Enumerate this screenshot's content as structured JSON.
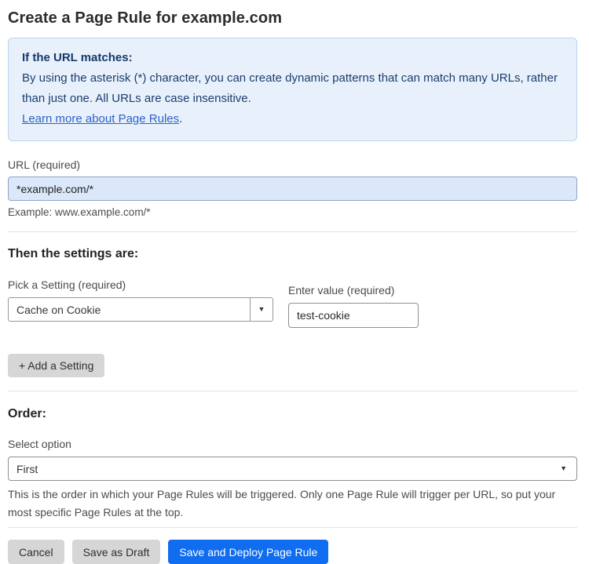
{
  "page": {
    "title": "Create a Page Rule for example.com"
  },
  "info_box": {
    "heading": "If the URL matches:",
    "body": "By using the asterisk (*) character, you can create dynamic patterns that can match many URLs, rather than just one. All URLs are case insensitive.",
    "link_label": "Learn more about Page Rules",
    "link_suffix": "."
  },
  "url_field": {
    "label": "URL (required)",
    "value": "*example.com/*",
    "helper": "Example: www.example.com/*"
  },
  "settings_section": {
    "heading": "Then the settings are:",
    "setting_label": "Pick a Setting (required)",
    "setting_value": "Cache on Cookie",
    "value_label": "Enter value (required)",
    "value_value": "test-cookie",
    "add_button_label": "+ Add a Setting",
    "dropdown_caret": "▼"
  },
  "order_section": {
    "heading": "Order:",
    "select_label": "Select option",
    "select_value": "First",
    "dropdown_caret": "▼",
    "helper": "This is the order in which your Page Rules will be triggered. Only one Page Rule will trigger per URL, so put your most specific Page Rules at the top."
  },
  "actions": {
    "cancel_label": "Cancel",
    "save_draft_label": "Save as Draft",
    "save_deploy_label": "Save and Deploy Page Rule"
  },
  "colors": {
    "info_bg": "#e8f1fb",
    "info_border": "#b9d3ee",
    "info_text": "#1b3d6e",
    "link": "#2b62ca",
    "url_input_bg": "#dbe8fa",
    "gray_button_bg": "#d6d6d6",
    "primary_button_bg": "#106df0"
  }
}
